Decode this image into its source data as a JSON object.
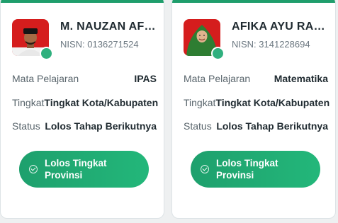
{
  "students": [
    {
      "name": "M. NAUZAN AFK...",
      "nisn": "NISN: 0136271524",
      "rows": [
        {
          "label": "Mata Pelajaran",
          "value": "IPAS"
        },
        {
          "label": "Tingkat",
          "value": "Tingkat Kota/Kabupaten"
        },
        {
          "label": "Status",
          "value": "Lolos Tahap Berikutnya"
        }
      ],
      "badge": "Lolos Tingkat Provinsi"
    },
    {
      "name": "AFIKA AYU RAM...",
      "nisn": "NISN: 3141228694",
      "rows": [
        {
          "label": "Mata Pelajaran",
          "value": "Matematika"
        },
        {
          "label": "Tingkat",
          "value": "Tingkat Kota/Kabupaten"
        },
        {
          "label": "Status",
          "value": "Lolos Tahap Berikutnya"
        }
      ],
      "badge": "Lolos Tingkat Provinsi"
    }
  ],
  "colors": {
    "accent": "#1f9e6c",
    "badge_start": "#1ea06d",
    "badge_end": "#23b77a",
    "online": "#2fb07e",
    "photo_bg": "#d51d1d"
  },
  "icons": {
    "online_dot": "status-online-icon",
    "badge_check": "check-circle-icon"
  }
}
